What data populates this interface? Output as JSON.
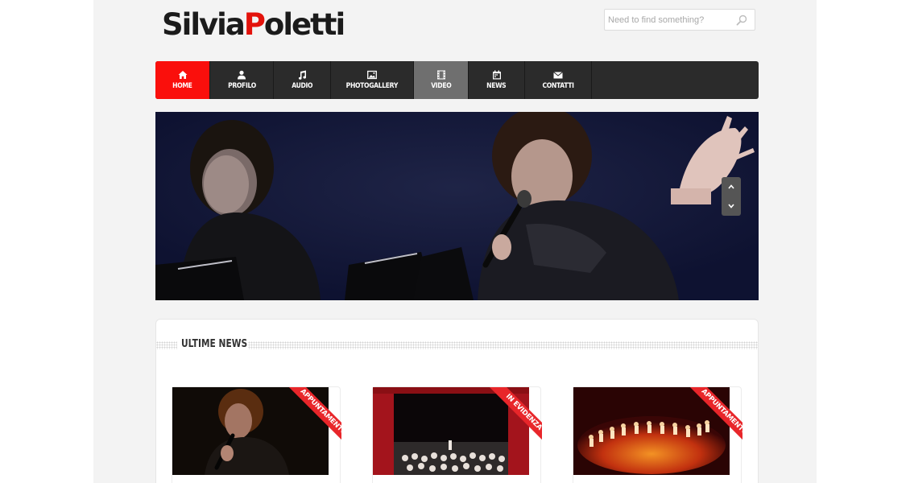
{
  "brand": {
    "first": "Silvia",
    "p": "P",
    "rest": "oletti",
    "accent": "#e3120b"
  },
  "search": {
    "placeholder": "Need to find something?",
    "icon": "search-icon"
  },
  "nav": {
    "items": [
      {
        "label": "HOME",
        "icon": "home-icon"
      },
      {
        "label": "PROFILO",
        "icon": "user-icon"
      },
      {
        "label": "AUDIO",
        "icon": "music-note-icon"
      },
      {
        "label": "PHOTOGALLERY",
        "icon": "picture-icon"
      },
      {
        "label": "VIDEO",
        "icon": "film-icon"
      },
      {
        "label": "NEWS",
        "icon": "calendar-icon"
      },
      {
        "label": "CONTATTI",
        "icon": "envelope-icon"
      }
    ],
    "active_color": "#fa0f0c",
    "selected_color": "#6f6f6f"
  },
  "hero": {
    "controls": [
      "chevron-up-icon",
      "chevron-down-icon"
    ]
  },
  "news": {
    "title": "ULTIME NEWS",
    "cards": [
      {
        "ribbon": "APPUNTAMENTO",
        "ribbon_color": "#e8262a"
      },
      {
        "ribbon": "IN EVIDENZA",
        "ribbon_color": "#e8262a"
      },
      {
        "ribbon": "APPUNTAMENTO",
        "ribbon_color": "#e8262a"
      }
    ]
  }
}
